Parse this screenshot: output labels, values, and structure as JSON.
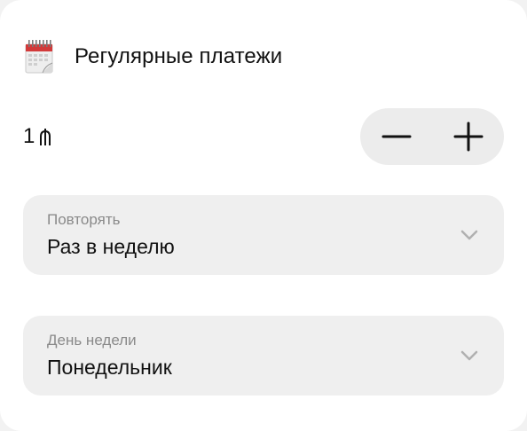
{
  "header": {
    "title": "Регулярные платежи",
    "icon": "calendar-icon"
  },
  "amount": {
    "value": "1",
    "currency_icon": "dram-currency-icon"
  },
  "stepper": {
    "minus_icon": "minus-icon",
    "plus_icon": "plus-icon"
  },
  "repeat_select": {
    "label": "Повторять",
    "value": "Раз в неделю",
    "icon": "chevron-down-icon"
  },
  "weekday_select": {
    "label": "День недели",
    "value": "Понедельник",
    "icon": "chevron-down-icon"
  },
  "colors": {
    "card_bg": "#ffffff",
    "control_bg": "#efefef",
    "text_primary": "#111111",
    "text_secondary": "#8a8a8a",
    "chevron": "#b0b0b0"
  }
}
